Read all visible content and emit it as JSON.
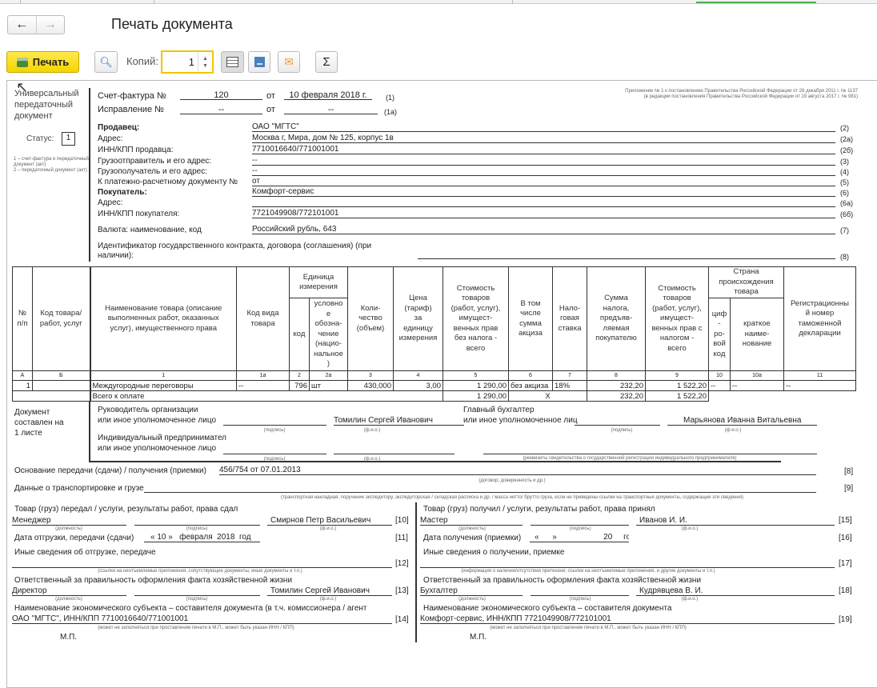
{
  "window": {
    "title": "Печать документа",
    "back_icon": "arrow-left-icon",
    "forward_icon": "arrow-right-icon"
  },
  "toolbar": {
    "print_label": "Печать",
    "copies_label": "Копий:",
    "copies_value": "1",
    "accent": "#f5d400"
  },
  "doc": {
    "doc_type": "Универсальный передаточный документ",
    "status_label": "Статус:",
    "status_value": "1",
    "status_note": "1 – счет-фактура и передаточный документ (акт)\n2 – передаточный документ (акт)",
    "appendix_1": "Приложение № 1 к постановлению Правительства Российской Федерации от 26 декабря 2011 г. № 1137",
    "appendix_2": "(в редакции постановления Правительства Российской Федерации от 19 августа 2017 г. № 981)",
    "invoice_label": "Счет-фактура №",
    "invoice_number": "120",
    "from": "от",
    "invoice_date": "10 февраля 2018 г.",
    "invoice_ref": "(1)",
    "correction_label": "Исправление №",
    "correction_number": "--",
    "correction_date": "--",
    "correction_ref": "(1а)",
    "fields": [
      {
        "label": "Продавец:",
        "value": "ОАО \"МГТС\"",
        "ref": "(2)",
        "bold": true
      },
      {
        "label": "Адрес:",
        "value": "Москва г, Мира, дом № 125, корпус 1в",
        "ref": "(2а)"
      },
      {
        "label": "ИНН/КПП продавца:",
        "value": "7710016640/771001001",
        "ref": "(2б)"
      },
      {
        "label": "Грузоотправитель и его адрес:",
        "value": "--",
        "ref": "(3)"
      },
      {
        "label": "Грузополучатель и его адрес:",
        "value": "--",
        "ref": "(4)"
      },
      {
        "label": "К платежно-расчетному документу №",
        "value": "   от",
        "ref": "(5)"
      },
      {
        "label": "Покупатель:",
        "value": "Комфорт-сервис",
        "ref": "(6)",
        "bold": true
      },
      {
        "label": "Адрес:",
        "value": "",
        "ref": "(6а)"
      },
      {
        "label": "ИНН/КПП покупателя:",
        "value": "7721049908/772101001",
        "ref": "(6б)"
      },
      {
        "label": "Валюта: наименование, код",
        "value": "Российский рубль, 643",
        "ref": "(7)"
      }
    ],
    "contract_label_1": "Идентификатор государственного контракта, договора (соглашения) (при",
    "contract_label_2": "наличии):",
    "contract_ref": "(8)"
  },
  "table": {
    "headers": [
      "№\nп/п",
      "Код товара/\nработ, услуг",
      "Наименование товара (описание\nвыполненных работ, оказанных\nуслуг), имущественного права",
      "Код вида\nтовара",
      "Единица\nизмерения",
      "Коли-\nчество\n(объем)",
      "Цена\n(тариф)\nза\nединицу\nизмерения",
      "Стоимость\nтоваров\n(работ, услуг),\nимущест-\nвенных прав\nбез налога -\nвсего",
      "В том\nчисле\nсумма\nакциза",
      "Нало-\nговая\nставка",
      "Сумма\nналога,\nпредъяв-\nляемая\nпокупателю",
      "Стоимость\nтоваров\n(работ, услуг),\nимущест-\nвенных прав с\nналогом -\nвсего",
      "Страна\nпроисхождения\nтовара",
      "Регистрационны\nй номер\nтаможенной\nдекларации"
    ],
    "subheaders": [
      "код",
      "условно\nе\nобозна-\nчение\n(нацио-\nнальное\n)",
      "циф\n-\nро-\nвой\nкод",
      "краткое\nнаиме-\nнование"
    ],
    "col_numbers": [
      "А",
      "Б",
      "1",
      "1а",
      "2",
      "2а",
      "3",
      "4",
      "5",
      "6",
      "7",
      "8",
      "9",
      "10",
      "10а",
      "11"
    ],
    "rows": [
      [
        "1",
        "",
        "Междугородные переговоры",
        "--",
        "796",
        "шт",
        "430,000",
        "3,00",
        "1 290,00",
        "без акциза",
        "18%",
        "232,20",
        "1 522,20",
        "--",
        "--",
        "--"
      ]
    ],
    "total": {
      "label": "Всего к оплате",
      "sum_without_tax": "1 290,00",
      "excise": "X",
      "tax": "232,20",
      "sum_with_tax": "1 522,20"
    }
  },
  "signatures": {
    "sheets": "Документ\nсоставлен на\n1 листе",
    "head_1": "Руководитель организации",
    "head_2": "или иное уполномоченное лицо",
    "head_name": "Томилин Сергей Иванович",
    "acc_1": "Главный бухгалтер",
    "acc_2": "или иное уполномоченное лиц",
    "acc_name": "Марьянова Иванна Витальевна",
    "ip_1": "Индивидуальный предпринимател",
    "ip_2": "или иное уполномоченное лицо",
    "cap_sign": "(подпись)",
    "cap_fio": "(ф.и.о.)",
    "cap_position": "(должность)",
    "cap_ip": "(реквизиты свидетельства о государственной  регистрации индивидуального предпринимателя)"
  },
  "transfer": {
    "basis_label": "Основание передачи (сдачи) / получения (приемки)",
    "basis_value": "456/754 от 07.01.2013",
    "basis_ref": "[8]",
    "basis_cap": "(договор; доверенность и др.)",
    "transport_label": "Данные о транспортировке и грузе",
    "transport_ref": "[9]",
    "transport_cap": "(транспортная накладная, поручение экспедитору, экспедиторская / складская расписка и др. / масса нетто/ брутто груза, если не приведены ссылки на транспортные документы, содержащие эти сведения)"
  },
  "left": {
    "handed": "Товар (груз) передал / услуги, результаты работ, права сдал",
    "position": "Менеджер",
    "name": "Смирнов Петр Васильевич",
    "ref10": "[10]",
    "date_label": "Дата отгрузки, передачи (сдачи)",
    "date_value": "« 10 »   февраля  2018  год",
    "ref11": "[11]",
    "other": "Иные сведения об отгрузке, передаче",
    "ref12": "[12]",
    "other_cap": "(ссылки на неотъемлемые приложения, сопутствующие документы, иные документы и т.п.)",
    "resp": "Ответственный за правильность оформления факта хозяйственной жизни",
    "resp_position": "Директор",
    "resp_name": "Томилин Сергей Иванович",
    "ref13": "[13]",
    "entity": "Наименование экономического субъекта – составителя документа (в т.ч. комиссионера / агент",
    "entity_value": "ОАО \"МГТС\", ИНН/КПП 7710016640/771001001",
    "ref14": "[14]",
    "entity_cap": "(может не заполняться при проставлении печати в М.П., может быть указан ИНН / КПП)",
    "stamp": "М.П."
  },
  "right": {
    "received": "Товар (груз) получил / услуги, результаты работ, права принял",
    "position": "Мастер",
    "name": "Иванов И. И.",
    "ref15": "[15]",
    "date_label": "Дата получения (приемки)",
    "date_value": "«      »                     20     год",
    "ref16": "[16]",
    "other": "Иные сведения о получении, приемке",
    "ref17": "[17]",
    "other_cap": "(информация о наличии/отсутствии претензии; ссылки на неотъемлемые приложения, и другие  документы и т.п.)",
    "resp": "Ответственный за правильность оформления факта хозяйственной жизни",
    "resp_position": "Бухгалтер",
    "resp_name": "Кудрявцева В. И.",
    "ref18": "[18]",
    "entity": "Наименование экономического субъекта – составителя документа",
    "entity_value": "Комфорт-сервис, ИНН/КПП 7721049908/772101001",
    "ref19": "[19]",
    "entity_cap": "(может не заполняться при проставлении печати в М.П., может быть указан ИНН / КПП)",
    "stamp": "М.П."
  }
}
